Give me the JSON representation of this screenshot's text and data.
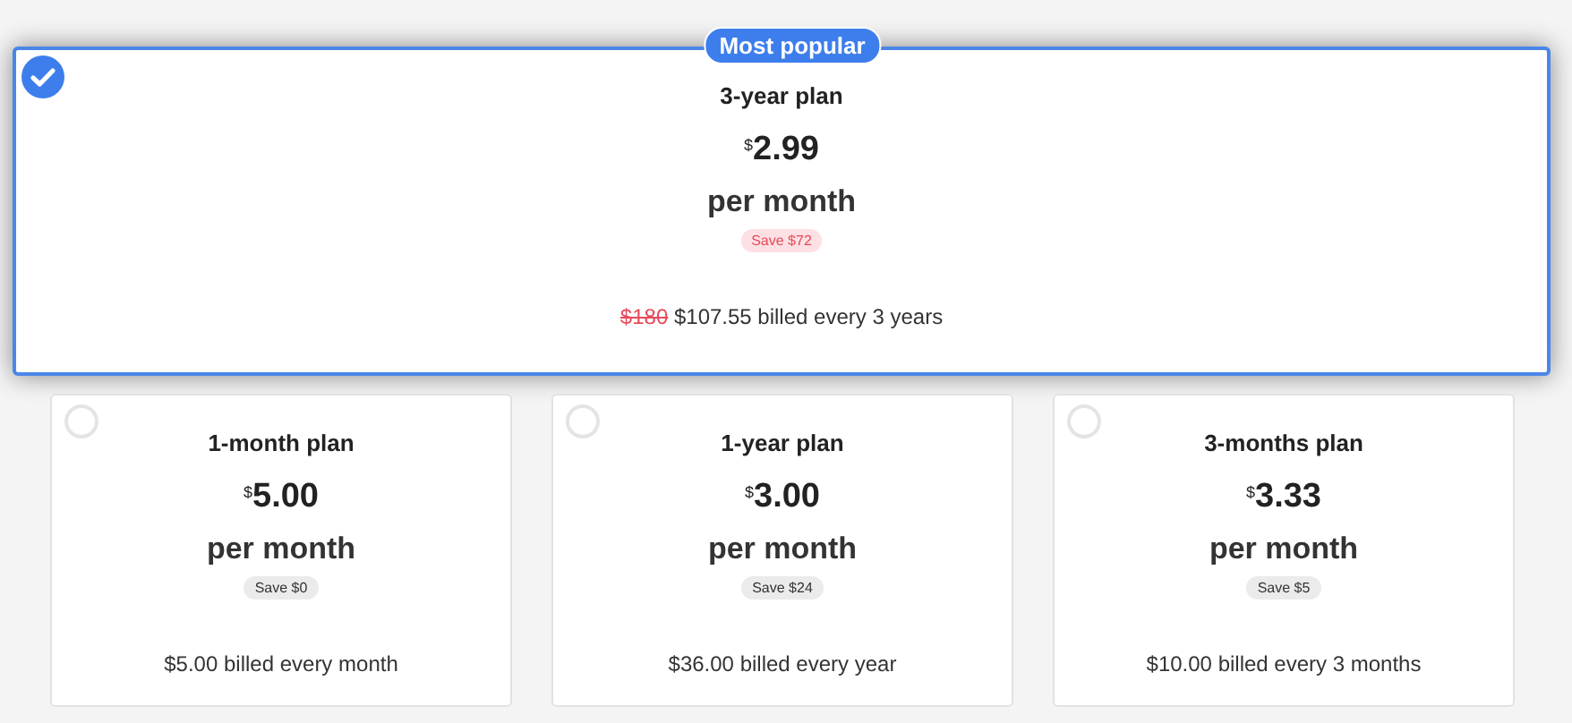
{
  "featured": {
    "badge": "Most popular",
    "selected": true,
    "title": "3-year plan",
    "currency": "$",
    "price": "2.99",
    "period": "per month",
    "save": "Save $72",
    "original_price": "$180",
    "billing": "$107.55 billed every 3 years"
  },
  "plans": [
    {
      "selected": false,
      "title": "1-month plan",
      "currency": "$",
      "price": "5.00",
      "period": "per month",
      "save": "Save $0",
      "billing": "$5.00 billed every month"
    },
    {
      "selected": false,
      "title": "1-year plan",
      "currency": "$",
      "price": "3.00",
      "period": "per month",
      "save": "Save $24",
      "billing": "$36.00 billed every year"
    },
    {
      "selected": false,
      "title": "3-months plan",
      "currency": "$",
      "price": "3.33",
      "period": "per month",
      "save": "Save $5",
      "billing": "$10.00 billed every 3 months"
    }
  ]
}
